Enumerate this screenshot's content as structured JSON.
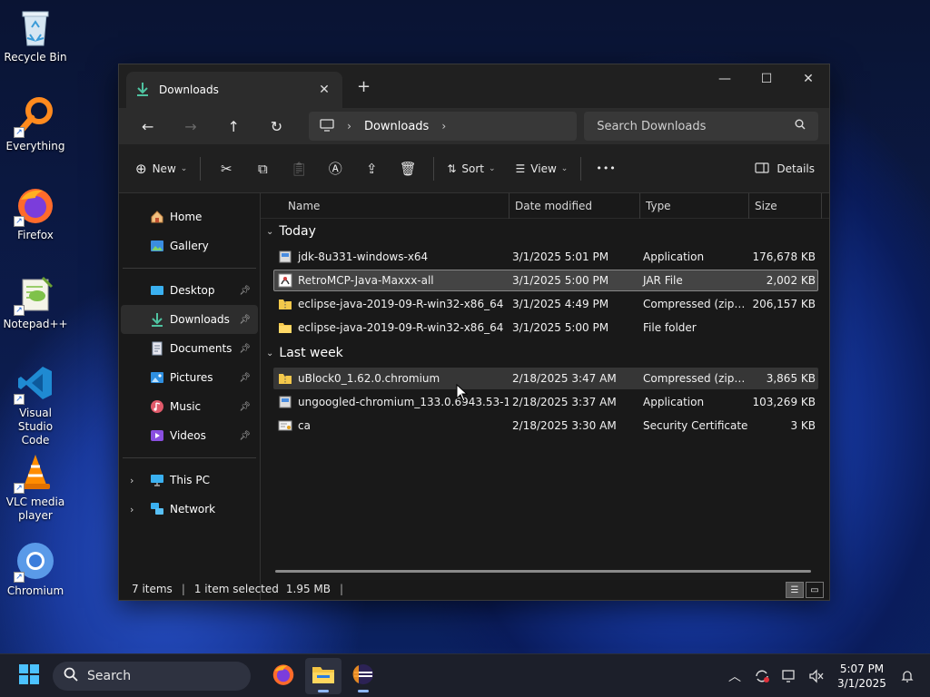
{
  "desktop": {
    "icons": [
      {
        "label": "Recycle Bin"
      },
      {
        "label": "Everything"
      },
      {
        "label": "Firefox"
      },
      {
        "label": "Notepad++"
      },
      {
        "label": "Visual Studio Code"
      },
      {
        "label": "VLC media player"
      },
      {
        "label": "Chromium"
      }
    ]
  },
  "window": {
    "tab_title": "Downloads",
    "tab_close": "✕",
    "new_tab": "+",
    "controls": {
      "minimize": "—",
      "maximize": "☐",
      "close": "✕"
    },
    "breadcrumb": {
      "current": "Downloads"
    },
    "search_placeholder": "Search Downloads",
    "toolbar": {
      "new_label": "New",
      "sort_label": "Sort",
      "view_label": "View",
      "more_label": "•••",
      "details_label": "Details"
    }
  },
  "sidebar": {
    "home": "Home",
    "gallery": "Gallery",
    "desktop": "Desktop",
    "downloads": "Downloads",
    "documents": "Documents",
    "pictures": "Pictures",
    "music": "Music",
    "videos": "Videos",
    "this_pc": "This PC",
    "network": "Network"
  },
  "columns": {
    "name": "Name",
    "date": "Date modified",
    "type": "Type",
    "size": "Size"
  },
  "groups": {
    "today": {
      "label": "Today",
      "files": [
        {
          "name": "jdk-8u331-windows-x64",
          "date": "3/1/2025 5:01 PM",
          "type": "Application",
          "size": "176,678 KB",
          "icon": "installer-icon"
        },
        {
          "name": "RetroMCP-Java-Maxxx-all",
          "date": "3/1/2025 5:00 PM",
          "type": "JAR File",
          "size": "2,002 KB",
          "icon": "jar-icon"
        },
        {
          "name": "eclipse-java-2019-09-R-win32-x86_64",
          "date": "3/1/2025 4:49 PM",
          "type": "Compressed (zipp...",
          "size": "206,157 KB",
          "icon": "zip-folder-icon"
        },
        {
          "name": "eclipse-java-2019-09-R-win32-x86_64",
          "date": "3/1/2025 5:00 PM",
          "type": "File folder",
          "size": "",
          "icon": "folder-icon"
        }
      ]
    },
    "last_week": {
      "label": "Last week",
      "files": [
        {
          "name": "uBlock0_1.62.0.chromium",
          "date": "2/18/2025 3:47 AM",
          "type": "Compressed (zipp...",
          "size": "3,865 KB",
          "icon": "zip-folder-icon"
        },
        {
          "name": "ungoogled-chromium_133.0.6943.53-1.1...",
          "date": "2/18/2025 3:37 AM",
          "type": "Application",
          "size": "103,269 KB",
          "icon": "installer-icon"
        },
        {
          "name": "ca",
          "date": "2/18/2025 3:30 AM",
          "type": "Security Certificate",
          "size": "3 KB",
          "icon": "certificate-icon"
        }
      ]
    }
  },
  "status": {
    "items": "7 items",
    "selected": "1 item selected",
    "size": "1.95 MB",
    "sep": "|"
  },
  "taskbar": {
    "search_label": "Search",
    "time": "5:07 PM",
    "date": "3/1/2025"
  }
}
